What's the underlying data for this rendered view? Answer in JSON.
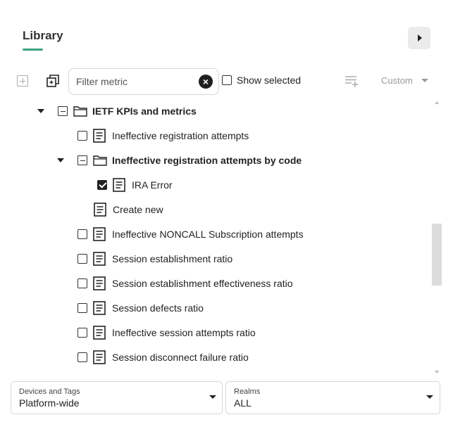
{
  "header": {
    "title": "Library"
  },
  "toolbar": {
    "filter_placeholder": "Filter metric",
    "show_selected_label": "Show selected",
    "show_selected_checked": false,
    "custom_label": "Custom"
  },
  "tree": {
    "group": {
      "label": "IETF KPIs and metrics",
      "expanded": true
    },
    "items": [
      {
        "label": "Ineffective registration attempts",
        "checked": false
      },
      {
        "label": "Ineffective registration attempts by code",
        "expanded": true,
        "is_folder": true
      },
      {
        "label": "IRA Error",
        "checked": true
      },
      {
        "label": "Create new"
      },
      {
        "label": "Ineffective NONCALL Subscription attempts",
        "checked": false
      },
      {
        "label": "Session establishment ratio",
        "checked": false
      },
      {
        "label": "Session establishment effectiveness ratio",
        "checked": false
      },
      {
        "label": "Session defects ratio",
        "checked": false
      },
      {
        "label": "Ineffective session attempts ratio",
        "checked": false
      },
      {
        "label": "Session disconnect failure ratio",
        "checked": false
      }
    ]
  },
  "footer": {
    "devices": {
      "caption": "Devices and Tags",
      "value": "Platform-wide"
    },
    "realms": {
      "caption": "Realms",
      "value": "ALL"
    }
  },
  "icons": {
    "expand": "caret-right-icon",
    "add": "add-square-icon",
    "copy": "copy-stack-icon",
    "clear": "close-circle-icon",
    "add_list": "playlist-add-icon",
    "folder": "folder-icon",
    "doc": "document-icon"
  },
  "colors": {
    "accent": "#3aa57f",
    "text": "#222222",
    "muted": "#999999",
    "button_bg": "#ebebeb"
  }
}
